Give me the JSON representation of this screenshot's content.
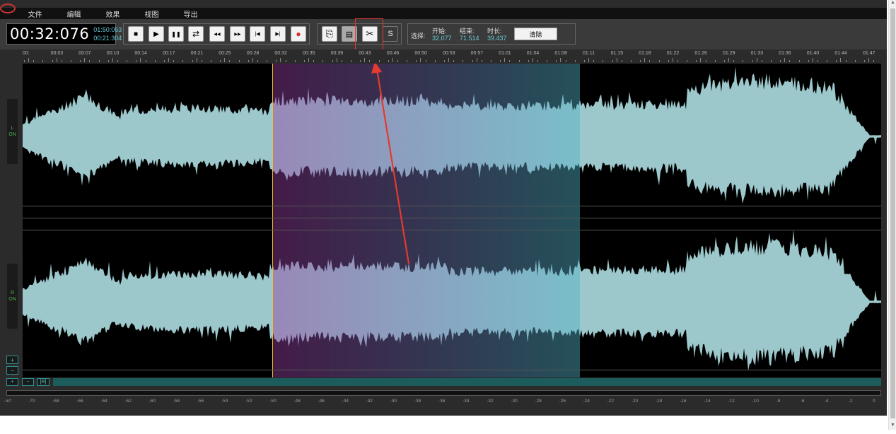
{
  "menu": [
    "文件",
    "编辑",
    "效果",
    "视图",
    "导出"
  ],
  "time": {
    "current": "00:32:076",
    "total": "01:50:053",
    "selection": "00:21:304"
  },
  "transport": [
    {
      "name": "stop-button",
      "glyph": "■"
    },
    {
      "name": "play-button",
      "glyph": "▶"
    },
    {
      "name": "pause-button",
      "glyph": "❚❚"
    },
    {
      "name": "loop-button",
      "glyph": "⇄"
    },
    {
      "name": "rewind-button",
      "glyph": "◀◀"
    },
    {
      "name": "fast-forward-button",
      "glyph": "▶▶"
    },
    {
      "name": "skip-start-button",
      "glyph": "|◀"
    },
    {
      "name": "skip-end-button",
      "glyph": "▶|"
    },
    {
      "name": "record-button",
      "glyph": "●"
    }
  ],
  "edit": [
    {
      "name": "copy-button",
      "glyph": "⎘"
    },
    {
      "name": "paste-button",
      "glyph": "▤"
    },
    {
      "name": "cut-button",
      "glyph": "✂"
    },
    {
      "name": "s-button",
      "glyph": "S"
    }
  ],
  "selection": {
    "label": "选择:",
    "start_label": "开始:",
    "start": "32.077",
    "end_label": "结束:",
    "end": "71.514",
    "duration_label": "时长:",
    "duration": "39.437",
    "clear": "清除"
  },
  "ruler": [
    "00:",
    "00:03",
    "00:07",
    "00:10",
    "00:14",
    "00:17",
    "00:21",
    "00:25",
    "00:28",
    "00:32",
    "00:35",
    "00:39",
    "00:43",
    "00:46",
    "00:50",
    "00:53",
    "00:57",
    "01:01",
    "01:04",
    "01:08",
    "01:11",
    "01:15",
    "01:18",
    "01:22",
    "01:26",
    "01:29",
    "01:33",
    "01:36",
    "01:40",
    "01:44",
    "01:47"
  ],
  "channels": [
    {
      "letter": "L",
      "state": "ON"
    },
    {
      "letter": "R",
      "state": "ON"
    }
  ],
  "zoom": {
    "in": "+",
    "out": "−"
  },
  "hzoom": {
    "in": "+",
    "out": "−",
    "reset": "[R]"
  },
  "db_scale": [
    "-inf",
    "-70",
    "-68",
    "-66",
    "-64",
    "-62",
    "-60",
    "-58",
    "-56",
    "-54",
    "-52",
    "-50",
    "-48",
    "-46",
    "-44",
    "-42",
    "-40",
    "-38",
    "-36",
    "-34",
    "-32",
    "-30",
    "-28",
    "-26",
    "-24",
    "-22",
    "-20",
    "-18",
    "-16",
    "-14",
    "-12",
    "-10",
    "-8",
    "-6",
    "-4",
    "-2",
    "0"
  ],
  "colors": {
    "wave": "#9cc7cb",
    "accent": "#6ac8d6",
    "cursor": "#f2c12e",
    "highlight_box": "#e53a2f"
  }
}
